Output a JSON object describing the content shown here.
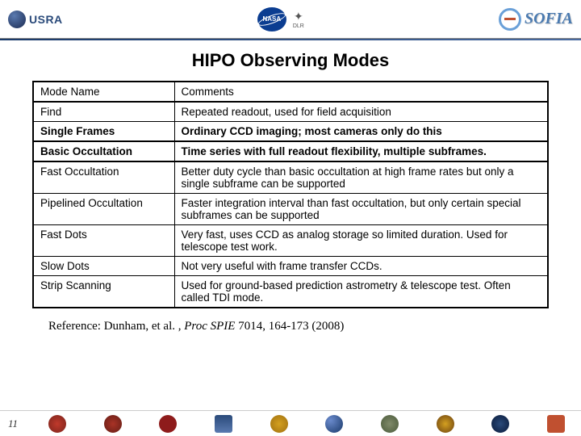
{
  "header": {
    "left": {
      "text": "USRA"
    },
    "center": {
      "nasa": "NASA",
      "dlr": "DLR"
    },
    "right": {
      "text": "SOFIA"
    }
  },
  "title": "HIPO Observing Modes",
  "table": {
    "headers": {
      "col1": "Mode Name",
      "col2": "Comments"
    },
    "rows": [
      {
        "mode": "Find",
        "comment": "Repeated readout, used for field acquisition",
        "bold": false
      },
      {
        "mode": "Single Frames",
        "comment": "Ordinary CCD imaging; most cameras only do this",
        "bold": true
      },
      {
        "mode": "Basic Occultation",
        "comment": "Time series with full readout flexibility, multiple subframes.",
        "bold": true
      },
      {
        "mode": "Fast Occultation",
        "comment": "Better duty cycle than basic occultation at high frame rates but only a single subframe can be supported",
        "bold": false
      },
      {
        "mode": "Pipelined Occultation",
        "comment": "Faster integration interval than fast occultation, but only certain special subframes can be supported",
        "bold": false
      },
      {
        "mode": "Fast Dots",
        "comment": "Very fast, uses CCD as analog storage so limited duration. Used for telescope test work.",
        "bold": false
      },
      {
        "mode": "Slow Dots",
        "comment": "Not very useful with frame transfer CCDs.",
        "bold": false
      },
      {
        "mode": "Strip Scanning",
        "comment": "Used for ground-based prediction astrometry & telescope test. Often called TDI mode.",
        "bold": false
      }
    ]
  },
  "reference": {
    "prefix": "Reference:  Dunham, et al. , ",
    "italic": "Proc SPIE ",
    "suffix": "7014, 164-173 (2008)"
  },
  "page_number": "11"
}
